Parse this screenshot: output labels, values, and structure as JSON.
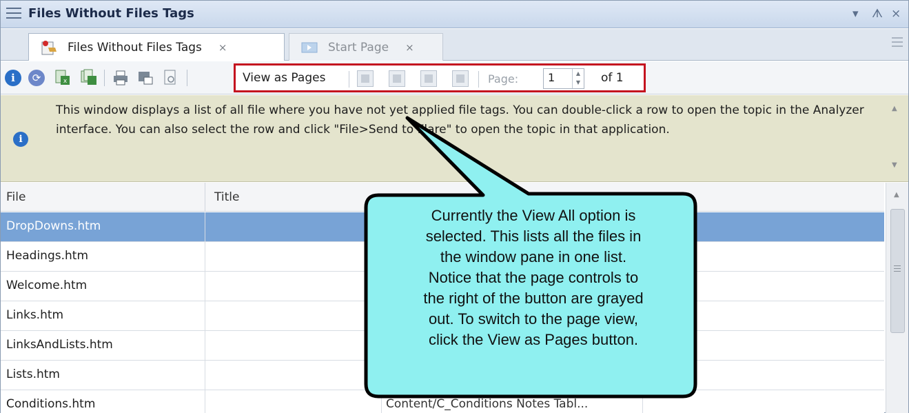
{
  "window": {
    "title": "Files Without Files Tags",
    "controls": [
      "▾",
      "ᗑ",
      "×"
    ]
  },
  "tabs": [
    {
      "label": "Files Without Files Tags",
      "close": "×",
      "active": true
    },
    {
      "label": "Start Page",
      "close": "×",
      "active": false
    }
  ],
  "toolbar": {
    "view_as_pages": "View as Pages",
    "page_label": "Page:",
    "page_value": "1",
    "of_label": "of 1"
  },
  "info": {
    "text": "This window displays a list of all file where you have not yet applied file tags. You can double-click a row to open the topic in the Analyzer interface. You can also select the row and click \"File>Send to Flare\" to open the topic in that application."
  },
  "grid": {
    "columns": [
      "File",
      "Title"
    ],
    "rows": [
      {
        "file": "DropDowns.htm",
        "path": "",
        "selected": true
      },
      {
        "file": "Headings.htm",
        "path": ""
      },
      {
        "file": "Welcome.htm",
        "path": ""
      },
      {
        "file": "Links.htm",
        "path": ""
      },
      {
        "file": "LinksAndLists.htm",
        "path": ""
      },
      {
        "file": "Lists.htm",
        "path": ""
      },
      {
        "file": "Conditions.htm",
        "path": "Content/C_Conditions Notes Tabl..."
      }
    ]
  },
  "callout": {
    "lines": [
      "Currently the View All option is",
      "selected. This lists all the files in",
      "the window pane in one list.",
      "Notice that the page controls to",
      "the right of the button are grayed",
      "out. To switch to the page view,",
      "click the View as Pages button."
    ],
    "fill": "#8ff0f0",
    "border": "#000000"
  },
  "colors": {
    "highlight_box": "#c4121f",
    "selected_row": "#78a3d6",
    "info_panel": "#e4e4cd"
  }
}
